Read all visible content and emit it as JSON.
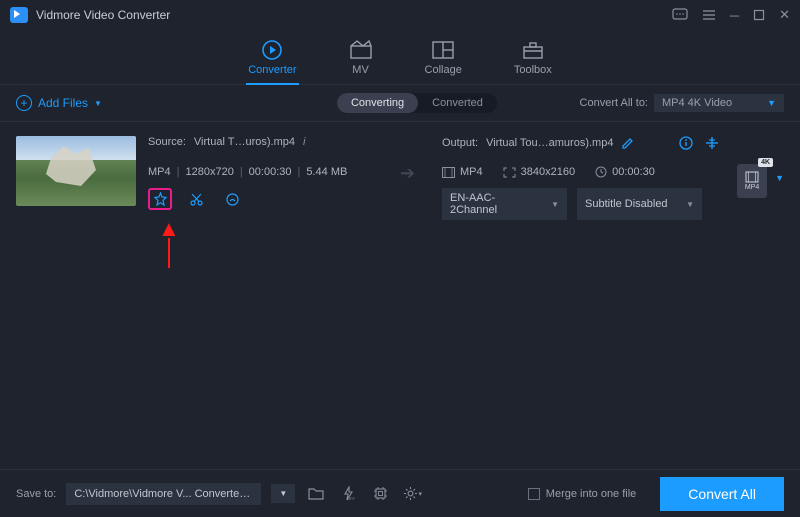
{
  "app": {
    "title": "Vidmore Video Converter"
  },
  "nav": {
    "tabs": [
      {
        "label": "Converter"
      },
      {
        "label": "MV"
      },
      {
        "label": "Collage"
      },
      {
        "label": "Toolbox"
      }
    ]
  },
  "subbar": {
    "add_files": "Add Files",
    "toggle": {
      "converting": "Converting",
      "converted": "Converted"
    },
    "convert_all_to_label": "Convert All to:",
    "convert_all_to_value": "MP4 4K Video"
  },
  "item": {
    "source_label": "Source:",
    "source_name": "Virtual T…uros).mp4",
    "format": "MP4",
    "resolution": "1280x720",
    "duration": "00:00:30",
    "size": "5.44 MB",
    "output_label": "Output:",
    "output_name": "Virtual Tou…amuros).mp4",
    "out_format": "MP4",
    "out_resolution": "3840x2160",
    "out_duration": "00:00:30",
    "audio_option": "EN-AAC-2Channel",
    "subtitle_option": "Subtitle Disabled",
    "format_icon_label": "MP4",
    "format_icon_badge": "4K"
  },
  "footer": {
    "save_to_label": "Save to:",
    "save_path": "C:\\Vidmore\\Vidmore V... Converter\\Converted",
    "merge_label": "Merge into one file",
    "convert_button": "Convert All"
  }
}
